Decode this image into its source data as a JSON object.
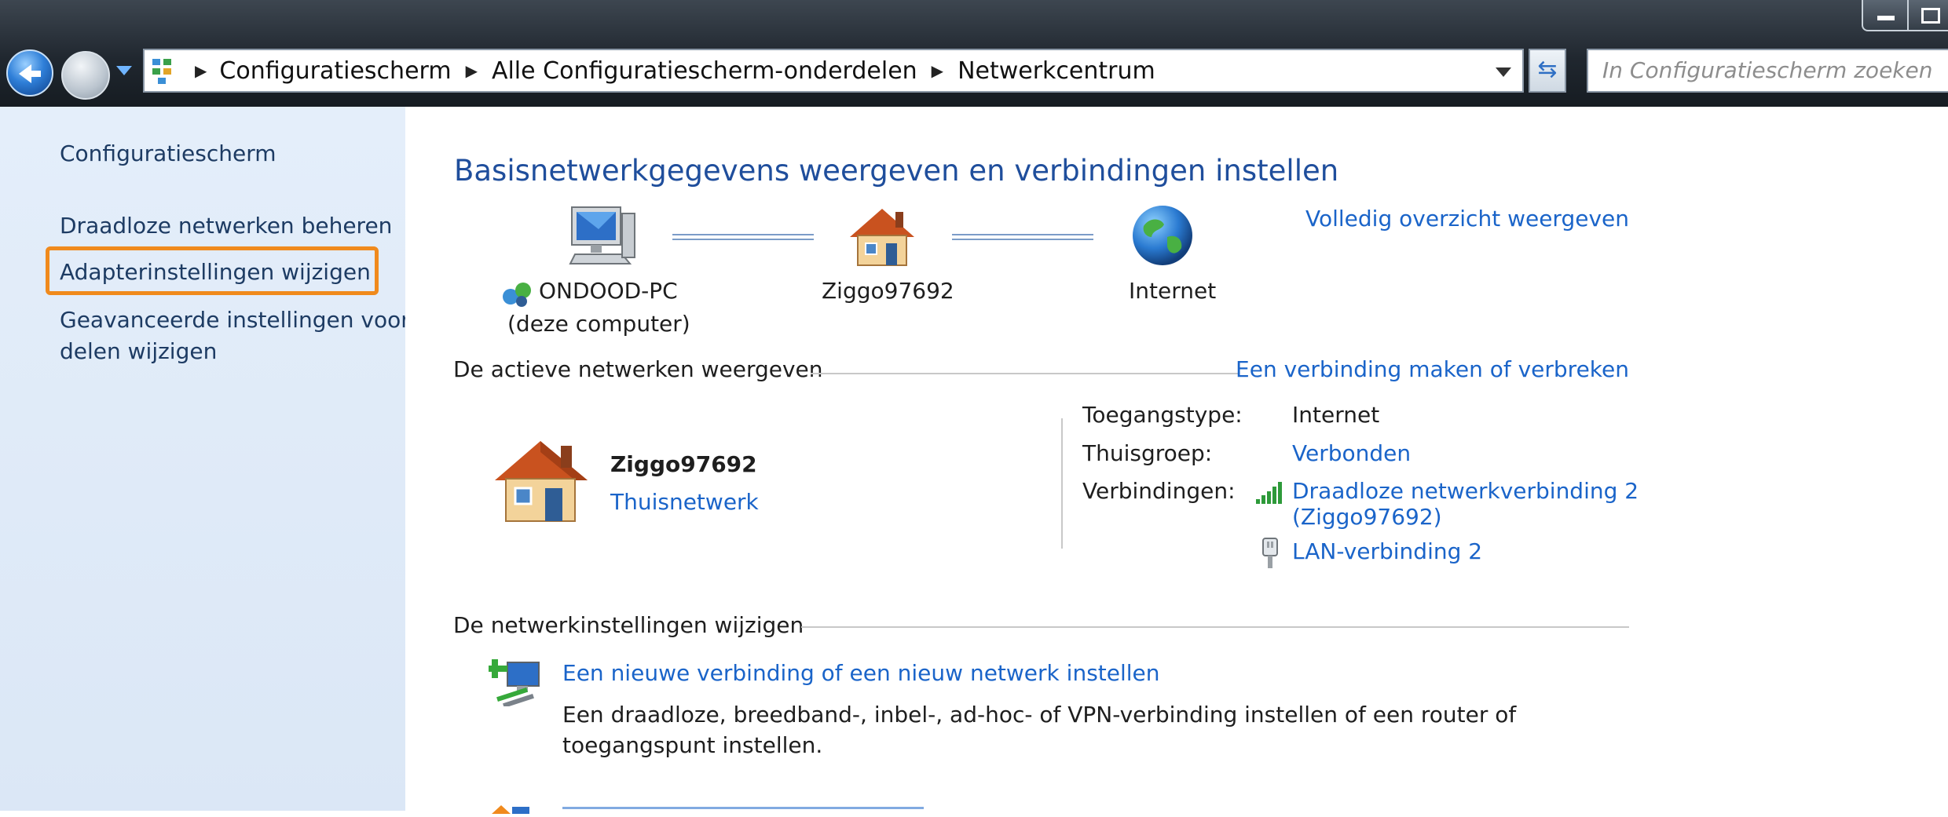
{
  "window": {
    "address": {
      "crumbs": [
        "Configuratiescherm",
        "Alle Configuratiescherm-onderdelen",
        "Netwerkcentrum"
      ]
    },
    "search_placeholder": "In Configuratiescherm zoeken"
  },
  "sidebar": {
    "home_link": "Configuratiescherm",
    "items": [
      {
        "label": "Draadloze netwerken beheren"
      },
      {
        "label": "Adapterinstellingen wijzigen"
      },
      {
        "label_line1": "Geavanceerde instellingen voor",
        "label_line2": "delen wijzigen"
      }
    ],
    "highlight_color": "#f08a1d"
  },
  "main": {
    "heading": "Basisnetwerkgegevens weergeven en verbindingen instellen",
    "full_view_link": "Volledig overzicht weergeven",
    "map": {
      "computer_name": "ONDOOD-PC",
      "computer_sub": "(deze computer)",
      "network_name": "Ziggo97692",
      "internet_label": "Internet"
    },
    "active_section": {
      "title": "De actieve netwerken weergeven",
      "connect_link": "Een verbinding maken of verbreken",
      "network_name": "Ziggo97692",
      "network_type": "Thuisnetwerk",
      "access_type_label": "Toegangstype:",
      "access_type_value": "Internet",
      "homegroup_label": "Thuisgroep:",
      "homegroup_value": "Verbonden",
      "connections_label": "Verbindingen:",
      "connection1_line1": "Draadloze netwerkverbinding 2",
      "connection1_line2": "(Ziggo97692)",
      "connection2": "LAN-verbinding 2"
    },
    "change_section": {
      "title": "De netwerkinstellingen wijzigen",
      "task1_link": "Een nieuwe verbinding of een nieuw netwerk instellen",
      "task1_desc_line1": "Een draadloze, breedband-, inbel-, ad-hoc- of VPN-verbinding instellen of een router of",
      "task1_desc_line2": "toegangspunt instellen."
    }
  }
}
